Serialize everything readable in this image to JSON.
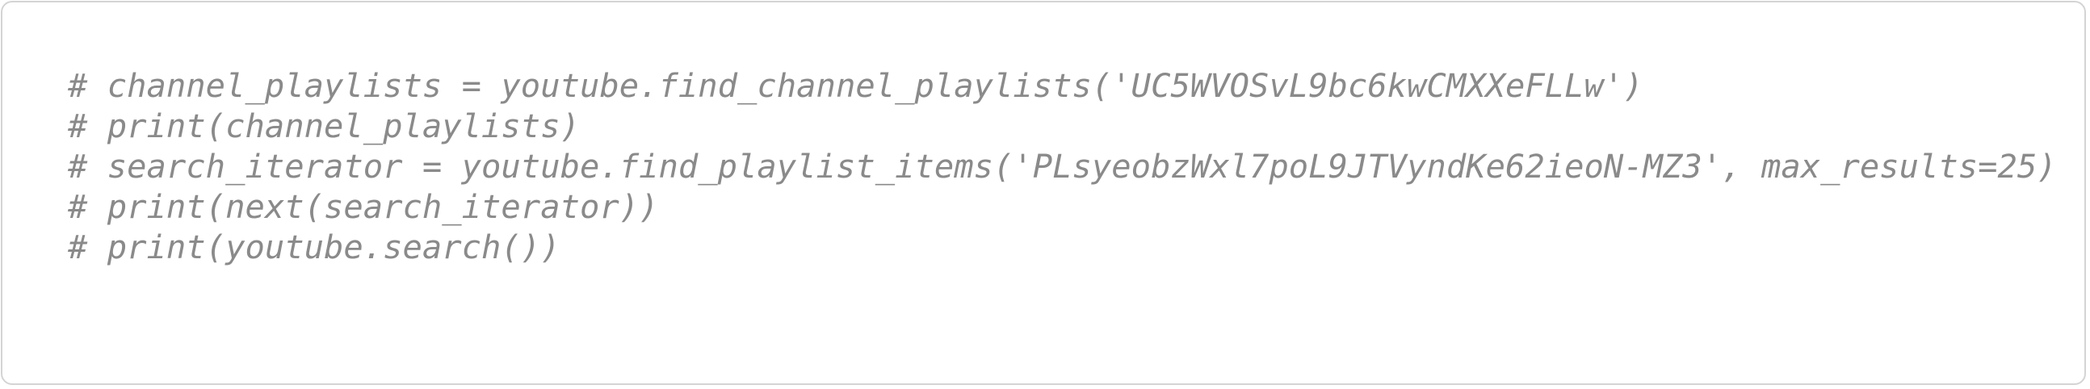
{
  "code": {
    "lines": [
      "# channel_playlists = youtube.find_channel_playlists('UC5WVOSvL9bc6kwCMXXeFLLw')",
      "# print(channel_playlists)",
      "# search_iterator = youtube.find_playlist_items('PLsyeobzWxl7poL9JTVyndKe62ieoN-MZ3', max_results=25)",
      "# print(next(search_iterator))",
      "# print(youtube.search())"
    ]
  },
  "colors": {
    "comment_text": "#8a8a8a",
    "border": "#d4d4d4",
    "background": "#ffffff"
  }
}
